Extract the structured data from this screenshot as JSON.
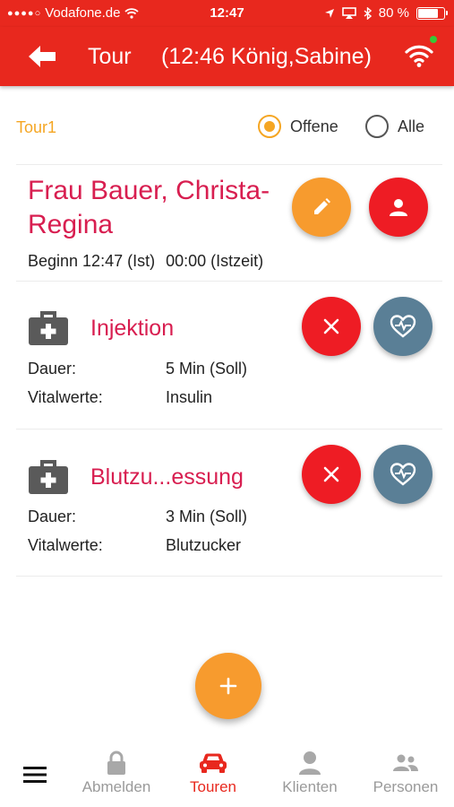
{
  "status_bar": {
    "carrier": "Vodafone.de",
    "time": "12:47",
    "battery": "80 %",
    "battery_level": 0.8
  },
  "app_bar": {
    "title": "Tour",
    "subtitle": "(12:46 König,Sabine)",
    "colors": {
      "primary": "#e8281e",
      "online": "#37c837"
    }
  },
  "filter": {
    "tour_name": "Tour1",
    "options": [
      {
        "label": "Offene",
        "selected": true
      },
      {
        "label": "Alle",
        "selected": false
      }
    ]
  },
  "client": {
    "name": "Frau Bauer, Christa-Regina",
    "begin": "Beginn 12:47 (Ist)",
    "actual_time": "00:00 (Istzeit)"
  },
  "tasks": [
    {
      "icon": "medical-kit-icon",
      "title": "Injektion",
      "rows": [
        {
          "key": "Dauer:",
          "value": "5 Min (Soll)"
        },
        {
          "key": "Vitalwerte:",
          "value": "Insulin"
        }
      ]
    },
    {
      "icon": "medical-kit-icon",
      "title": "Blutzu...essung",
      "rows": [
        {
          "key": "Dauer:",
          "value": "3 Min (Soll)"
        },
        {
          "key": "Vitalwerte:",
          "value": "Blutzucker"
        }
      ]
    }
  ],
  "bottom_nav": {
    "items": [
      {
        "label": "Abmelden",
        "icon": "lock-icon",
        "active": false
      },
      {
        "label": "Touren",
        "icon": "car-icon",
        "active": true
      },
      {
        "label": "Klienten",
        "icon": "person-icon",
        "active": false
      },
      {
        "label": "Personen",
        "icon": "people-icon",
        "active": false
      }
    ]
  },
  "colors": {
    "accent_orange": "#f79b2e",
    "danger_red": "#ee1c24",
    "heart_slate": "#5a7f96",
    "client_name": "#d81e50"
  }
}
